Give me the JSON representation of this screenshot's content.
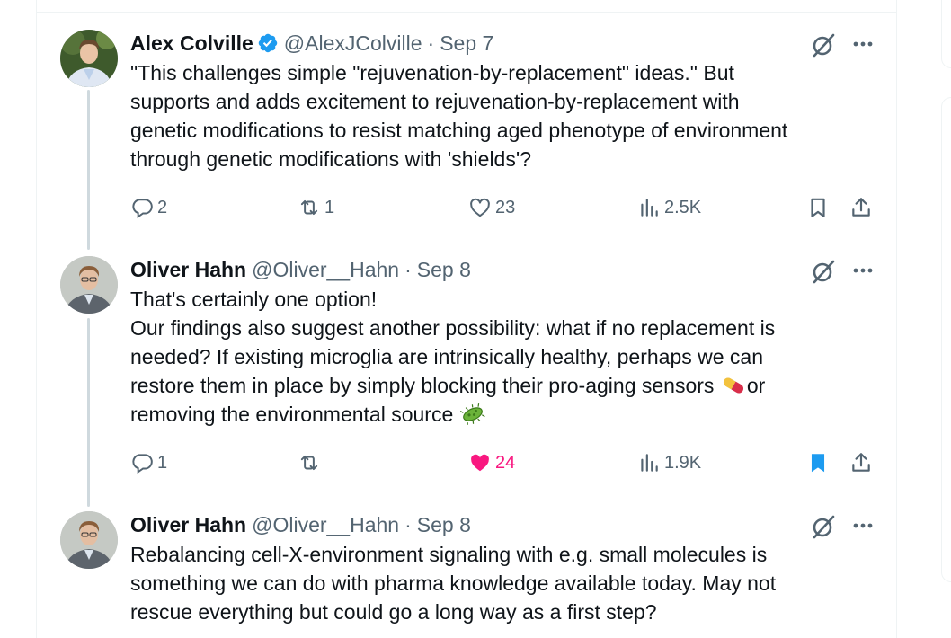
{
  "colors": {
    "text": "#0f1419",
    "secondary": "#536471",
    "verified": "#1d9bf0",
    "like_active": "#f91880",
    "bookmark_active": "#1d9bf0",
    "thread_line": "#cfd9de"
  },
  "tweets": [
    {
      "name": "Alex Colville",
      "verified": true,
      "handle": "@AlexJColville",
      "separator": "·",
      "date": "Sep 7",
      "lines": [
        "\"This challenges simple \"rejuvenation-by-replacement\" ideas.\" But",
        "supports and adds excitement to rejuvenation-by-replacement with",
        "genetic modifications to resist matching aged phenotype of environment",
        "through genetic modifications with 'shields'?"
      ],
      "replies": "2",
      "reposts": "1",
      "likes": "23",
      "liked": false,
      "views": "2.5K",
      "bookmarked": false
    },
    {
      "name": "Oliver Hahn",
      "verified": false,
      "handle": "@Oliver__Hahn",
      "separator": "·",
      "date": "Sep 8",
      "lines": [
        "That's certainly one option!",
        "Our findings also suggest another possibility: what if no replacement is",
        "needed? If existing microglia are intrinsically healthy, perhaps we can",
        "restore them in place by simply blocking their pro-aging sensors",
        "or",
        "removing the environmental source"
      ],
      "emoji": [
        "pill-emoji",
        "microbe-emoji"
      ],
      "replies": "1",
      "reposts": "",
      "likes": "24",
      "liked": true,
      "views": "1.9K",
      "bookmarked": true
    },
    {
      "name": "Oliver Hahn",
      "verified": false,
      "handle": "@Oliver__Hahn",
      "separator": "·",
      "date": "Sep 8",
      "lines": [
        "Rebalancing cell-X-environment signaling with e.g. small molecules is",
        "something we can do with pharma knowledge available today. May not",
        "rescue everything but could go a long way as a first step?"
      ]
    }
  ]
}
